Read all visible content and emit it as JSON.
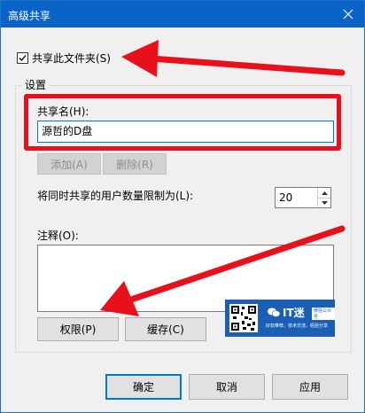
{
  "window": {
    "title": "高级共享"
  },
  "share": {
    "checkbox_label": "共享此文件夹(S)",
    "checked": true
  },
  "settings": {
    "group_title": "设置",
    "share_name_label": "共享名(H):",
    "share_name_value": "源哲的D盘",
    "add_button": "添加(A)",
    "delete_button": "删除(R)",
    "limit_label": "将同时共享的用户数量限制为(L):",
    "limit_value": "20",
    "comment_label": "注释(O):",
    "comment_value": "",
    "permissions_button": "权限(P)",
    "cache_button": "缓存(C)"
  },
  "footer": {
    "ok_button": "确定",
    "cancel_button": "取消",
    "apply_button": "应用"
  },
  "watermark": {
    "brand": "IT迷",
    "tag": "微信公众号",
    "subtitle": "好软推荐，技术交流，经验分享"
  },
  "colors": {
    "titlebar": "#0a64c8",
    "annotation_red": "#e8101b",
    "focus_blue": "#0078d7"
  }
}
